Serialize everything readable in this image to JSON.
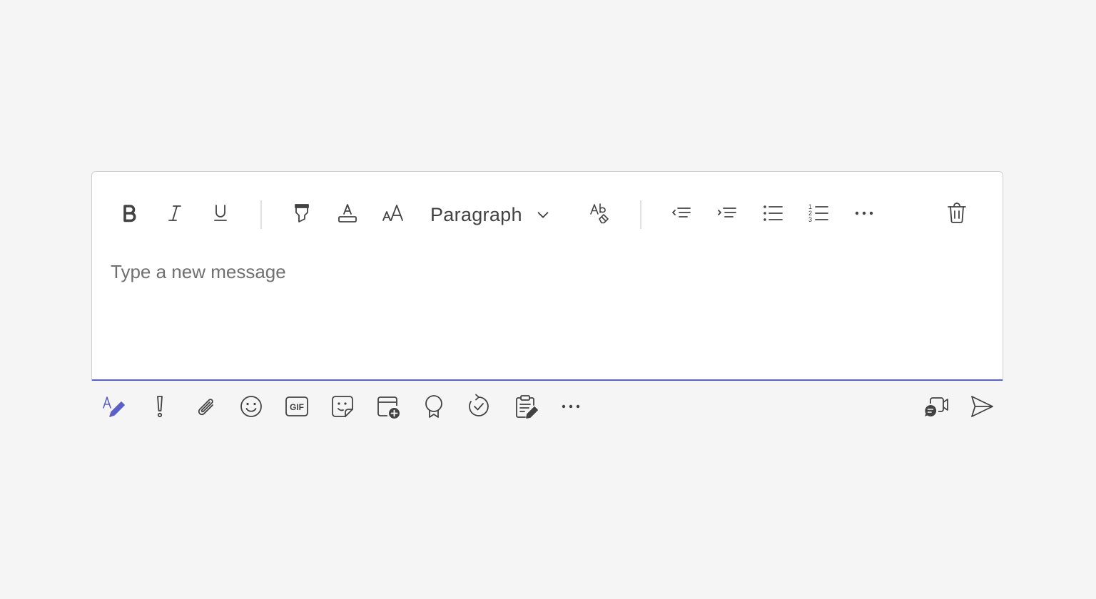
{
  "colors": {
    "accent": "#5b5fc7",
    "icon": "#424242",
    "background": "#f5f5f5",
    "placeholder": "#707070"
  },
  "format_toolbar": {
    "buttons": [
      {
        "name": "bold",
        "icon": "bold-icon"
      },
      {
        "name": "italic",
        "icon": "italic-icon"
      },
      {
        "name": "underline",
        "icon": "underline-icon"
      },
      {
        "name": "highlight",
        "icon": "highlighter-icon"
      },
      {
        "name": "font-color",
        "icon": "font-color-icon"
      },
      {
        "name": "font-size",
        "icon": "font-size-icon"
      },
      {
        "name": "clear-formatting",
        "icon": "clear-formatting-icon"
      },
      {
        "name": "decrease-indent",
        "icon": "decrease-indent-icon"
      },
      {
        "name": "increase-indent",
        "icon": "increase-indent-icon"
      },
      {
        "name": "bulleted-list",
        "icon": "bulleted-list-icon"
      },
      {
        "name": "numbered-list",
        "icon": "numbered-list-icon"
      },
      {
        "name": "more-options",
        "icon": "more-horizontal-icon"
      },
      {
        "name": "discard",
        "icon": "trash-icon"
      }
    ],
    "paragraph_select": {
      "value": "Paragraph",
      "icon": "chevron-down-icon"
    }
  },
  "message": {
    "placeholder": "Type a new message",
    "value": ""
  },
  "bottom_toolbar": {
    "buttons": [
      {
        "name": "format",
        "icon": "format-pen-icon",
        "active": true
      },
      {
        "name": "set-importance",
        "icon": "exclamation-icon"
      },
      {
        "name": "attach",
        "icon": "paperclip-icon"
      },
      {
        "name": "emoji",
        "icon": "emoji-icon"
      },
      {
        "name": "gif",
        "icon": "gif-icon",
        "label": "GIF"
      },
      {
        "name": "sticker",
        "icon": "sticker-icon"
      },
      {
        "name": "schedule-meeting",
        "icon": "calendar-add-icon"
      },
      {
        "name": "praise",
        "icon": "praise-badge-icon"
      },
      {
        "name": "loop",
        "icon": "loop-icon"
      },
      {
        "name": "forms",
        "icon": "clipboard-edit-icon"
      },
      {
        "name": "more-apps",
        "icon": "more-horizontal-icon"
      },
      {
        "name": "meet-now",
        "icon": "video-chat-icon"
      },
      {
        "name": "send",
        "icon": "send-icon"
      }
    ]
  }
}
